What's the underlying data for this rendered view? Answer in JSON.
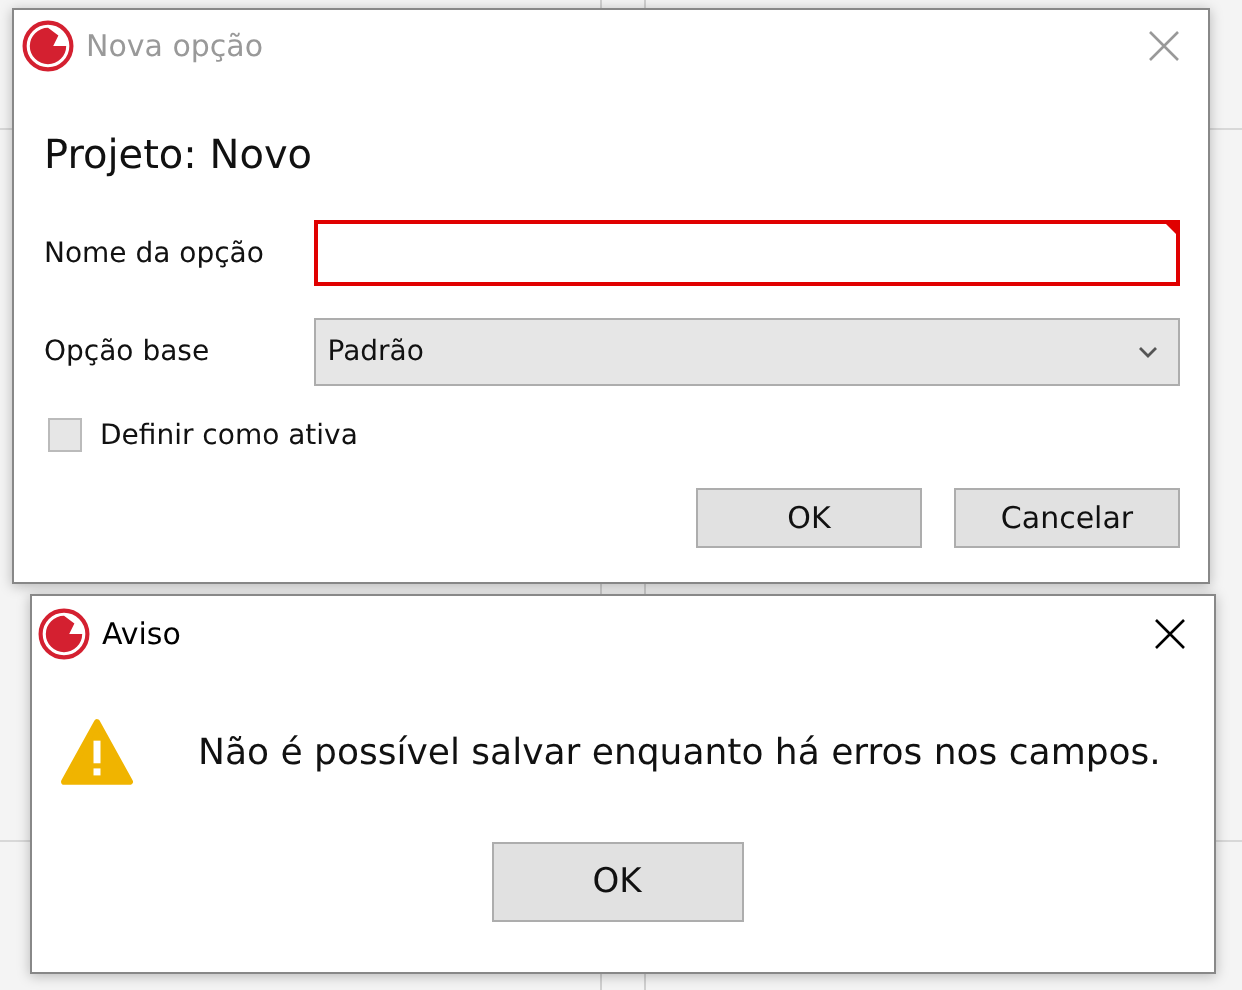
{
  "option_dialog": {
    "title": "Nova opção",
    "active": false,
    "heading": "Projeto: Novo",
    "name_field": {
      "label": "Nome da opção",
      "error": true
    },
    "base_option": {
      "label": "Opção base",
      "value": "Padrão"
    },
    "set_active": {
      "label": "Definir como ativa",
      "checked": false
    },
    "buttons": [
      "OK",
      "Cancelar"
    ]
  },
  "warning_dialog": {
    "title": "Aviso",
    "active": true,
    "message": "Não é possível salvar enquanto há erros nos campos.",
    "buttons": [
      "OK"
    ]
  }
}
